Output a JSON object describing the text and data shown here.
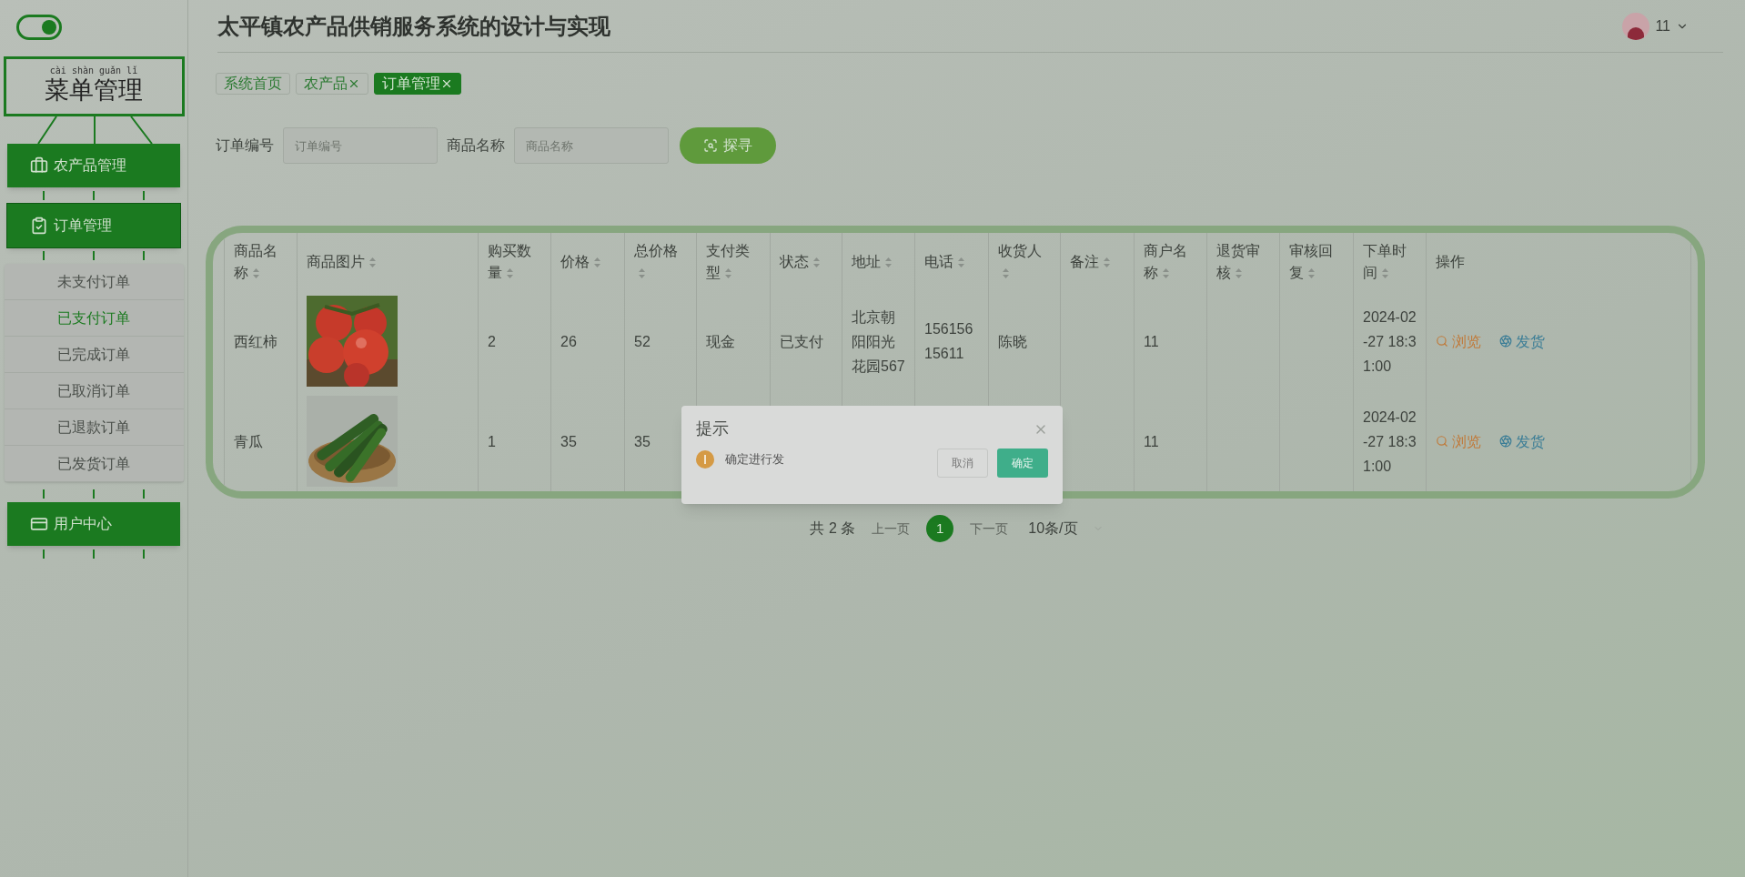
{
  "sidebar": {
    "toggle": {
      "on": true
    },
    "title": {
      "pinyin": "cài shàn guǎn lǐ",
      "text": "菜单管理"
    },
    "menus": [
      {
        "label": "农产品管理",
        "expanded": false
      },
      {
        "label": "订单管理",
        "expanded": true,
        "children": [
          {
            "label": "未支付订单",
            "selected": false
          },
          {
            "label": "已支付订单",
            "selected": true
          },
          {
            "label": "已完成订单",
            "selected": false
          },
          {
            "label": "已取消订单",
            "selected": false
          },
          {
            "label": "已退款订单",
            "selected": false
          },
          {
            "label": "已发货订单",
            "selected": false
          }
        ]
      },
      {
        "label": "用户中心",
        "expanded": false
      }
    ]
  },
  "header": {
    "title": "太平镇农产品供销服务系统的设计与实现",
    "user": {
      "name": "11"
    }
  },
  "tabs": [
    {
      "label": "系统首页",
      "selected": false,
      "closable": false
    },
    {
      "label": "农产品",
      "selected": false,
      "closable": true
    },
    {
      "label": "订单管理",
      "selected": true,
      "closable": true
    }
  ],
  "search": {
    "fields": [
      {
        "label": "订单编号",
        "placeholder": "订单编号"
      },
      {
        "label": "商品名称",
        "placeholder": "商品名称"
      }
    ],
    "button": "探寻"
  },
  "table": {
    "columns": [
      {
        "label": "商品名称",
        "sortable": true
      },
      {
        "label": "商品图片",
        "sortable": true
      },
      {
        "label": "购买数量",
        "sortable": true
      },
      {
        "label": "价格",
        "sortable": true
      },
      {
        "label": "总价格",
        "sortable": true
      },
      {
        "label": "支付类型",
        "sortable": true
      },
      {
        "label": "状态",
        "sortable": true
      },
      {
        "label": "地址",
        "sortable": true
      },
      {
        "label": "电话",
        "sortable": true
      },
      {
        "label": "收货人",
        "sortable": true
      },
      {
        "label": "备注",
        "sortable": true
      },
      {
        "label": "商户名称",
        "sortable": true
      },
      {
        "label": "退货审核",
        "sortable": true
      },
      {
        "label": "审核回复",
        "sortable": true
      },
      {
        "label": "下单时间",
        "sortable": true
      },
      {
        "label": "操作",
        "sortable": false
      }
    ],
    "rows": [
      {
        "name": "西红柿",
        "image": {
          "kind": "picture"
        },
        "qty": "2",
        "price": "26",
        "total": "52",
        "payment": "现金",
        "status": "已支付",
        "address": "北京朝阳阳光花园567",
        "phone": "15615615611",
        "recipient": "陈晓",
        "merchant": "11",
        "time": "2024-02-27 18:31:00",
        "actions": [
          {
            "label": "浏览",
            "kind": "view"
          },
          {
            "label": "发货",
            "kind": "ship"
          }
        ]
      },
      {
        "name": "青瓜",
        "image": {
          "kind": "picture"
        },
        "qty": "1",
        "price": "35",
        "total": "35",
        "merchant": "11",
        "time": "2024-02-27 18:31:00",
        "actions": [
          {
            "label": "浏览",
            "kind": "view"
          },
          {
            "label": "发货",
            "kind": "ship"
          }
        ]
      }
    ]
  },
  "pagination": {
    "total": "共 2 条",
    "prev": "上一页",
    "pages": [
      {
        "label": "1",
        "selected": true
      }
    ],
    "next": "下一页",
    "page_size": "10条/页"
  },
  "dialog": {
    "title": "提示",
    "message": "确定进行发",
    "buttons": [
      {
        "label": "取消",
        "kind": "secondary"
      },
      {
        "label": "确定",
        "kind": "primary"
      }
    ]
  }
}
